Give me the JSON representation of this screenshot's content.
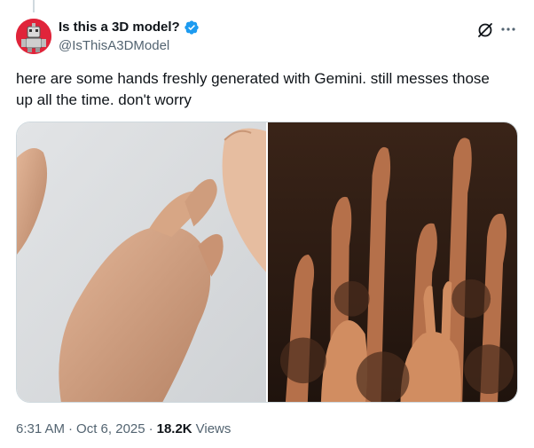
{
  "author": {
    "display_name": "Is this a 3D model?",
    "handle": "@IsThisA3DModel",
    "verified": true,
    "avatar_icon": "avatar-robot-icon"
  },
  "actions": {
    "grok_icon": "grok-slash-icon",
    "more_icon": "more-dots-icon",
    "more_glyph": "···"
  },
  "tweet": {
    "text_line1": "here are some hands freshly generated with Gemini. still messes those",
    "text_line2": "up all the time. don't worry"
  },
  "media": [
    {
      "description": "two hands close-up on grey background"
    },
    {
      "description": "crowd of raised hands"
    }
  ],
  "meta": {
    "time": "6:31 AM",
    "date": "Oct 6, 2025",
    "separator": "·",
    "views_count": "18.2K",
    "views_label": "Views"
  },
  "colors": {
    "text": "#0f1419",
    "secondary": "#536471",
    "verified": "#1d9bf0",
    "avatar_bg": "#e0243a"
  }
}
